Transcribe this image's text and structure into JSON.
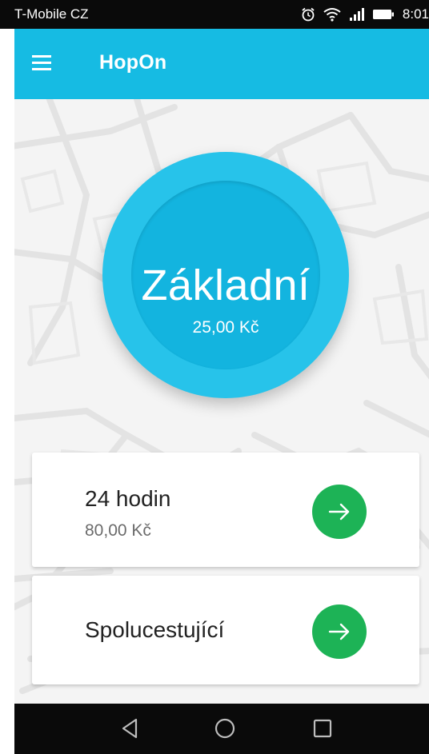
{
  "status_bar": {
    "carrier": "T-Mobile CZ",
    "time": "8:01",
    "icons": [
      "alarm-icon",
      "wifi-icon",
      "signal-icon",
      "battery-icon"
    ]
  },
  "app_bar": {
    "title": "HopOn",
    "menu_icon": "menu-icon"
  },
  "plan": {
    "name": "Základní",
    "price": "25,00 Kč"
  },
  "options": [
    {
      "title": "24 hodin",
      "price": "80,00 Kč",
      "action_icon": "arrow-right-icon"
    },
    {
      "title": "Spolucestující",
      "action_icon": "arrow-right-icon"
    }
  ],
  "nav_bar": {
    "icons": [
      "back-icon",
      "home-icon",
      "recents-icon"
    ]
  },
  "colors": {
    "app_bar": "#16bbe3",
    "circle_outer": "#27c3ea",
    "circle_inner": "#13b4df",
    "action_green": "#1db356",
    "status_bar": "#0a0a0a"
  }
}
